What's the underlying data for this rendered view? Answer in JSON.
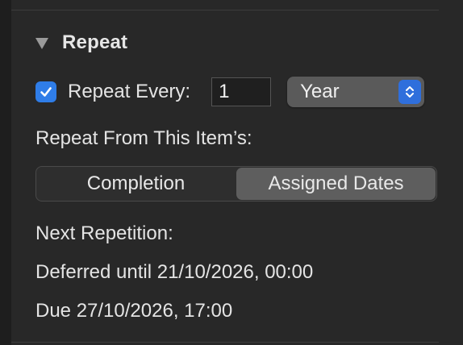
{
  "section": {
    "title": "Repeat",
    "expanded": true
  },
  "repeat": {
    "checkbox_checked": true,
    "label": "Repeat Every:",
    "interval_value": "1",
    "unit_value": "Year"
  },
  "repeat_from": {
    "label": "Repeat From This Item’s:",
    "options": [
      "Completion",
      "Assigned Dates"
    ],
    "selected": "Assigned Dates"
  },
  "next": {
    "label": "Next Repetition:",
    "deferred": "Deferred until 21/10/2026, 00:00",
    "due": "Due 27/10/2026, 17:00"
  },
  "colors": {
    "background": "#282828",
    "accent": "#2f7de8",
    "selected_segment": "#5e5e5e"
  },
  "icons": {
    "disclosure": "disclosure-triangle-down-icon",
    "checkbox": "checkmark-icon",
    "stepper": "up-down-chevron-icon"
  }
}
